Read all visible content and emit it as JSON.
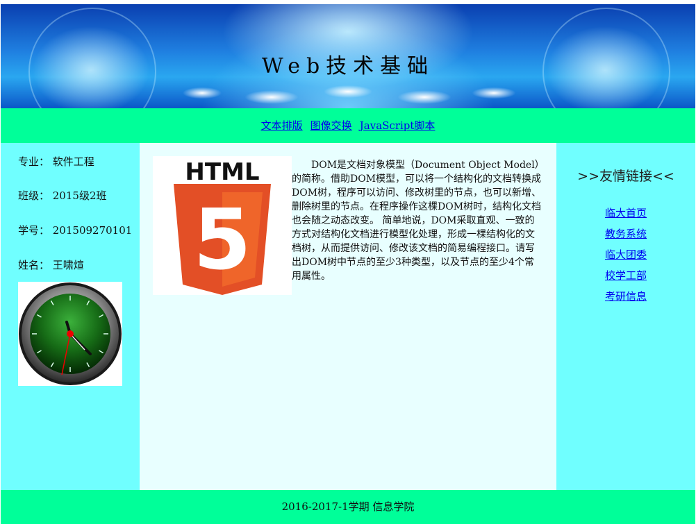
{
  "banner": {
    "title": "Web技术基础"
  },
  "nav": {
    "links": [
      "文本排版",
      "图像交换",
      "JavaScript脚本"
    ]
  },
  "profile": {
    "major": "专业：  软件工程",
    "class": "班级：  2015级2班",
    "student_id": "学号：  201509270101",
    "name": "姓名：  王啸煊"
  },
  "main": {
    "logo_text": "HTML",
    "logo_number": "5",
    "paragraph": "DOM是文档对象模型（Document Object Model）的简称。借助DOM模型，可以将一个结构化的文档转换成DOM树，程序可以访问、修改树里的节点，也可以新增、删除树里的节点。在程序操作这棵DOM树时，结构化文档也会随之动态改变。 简单地说，DOM采取直观、一致的方式对结构化文档进行模型化处理，形成一棵结构化的文档树，从而提供访问、修改该文档的简易编程接口。请写出DOM树中节点的至少3种类型，以及节点的至少4个常用属性。"
  },
  "sidebar": {
    "heading": ">>友情链接<<",
    "links": [
      "临大首页",
      "教务系统",
      "临大团委",
      "校学工部",
      "考研信息"
    ]
  },
  "footer": {
    "text": "2016-2017-1学期  信息学院"
  },
  "colors": {
    "nav_bg": "#00ff99",
    "side_bg": "#70ffff",
    "main_bg": "#e8ffff",
    "link": "#0000ee",
    "html5_orange": "#e34f26",
    "html5_light": "#ef652a"
  }
}
